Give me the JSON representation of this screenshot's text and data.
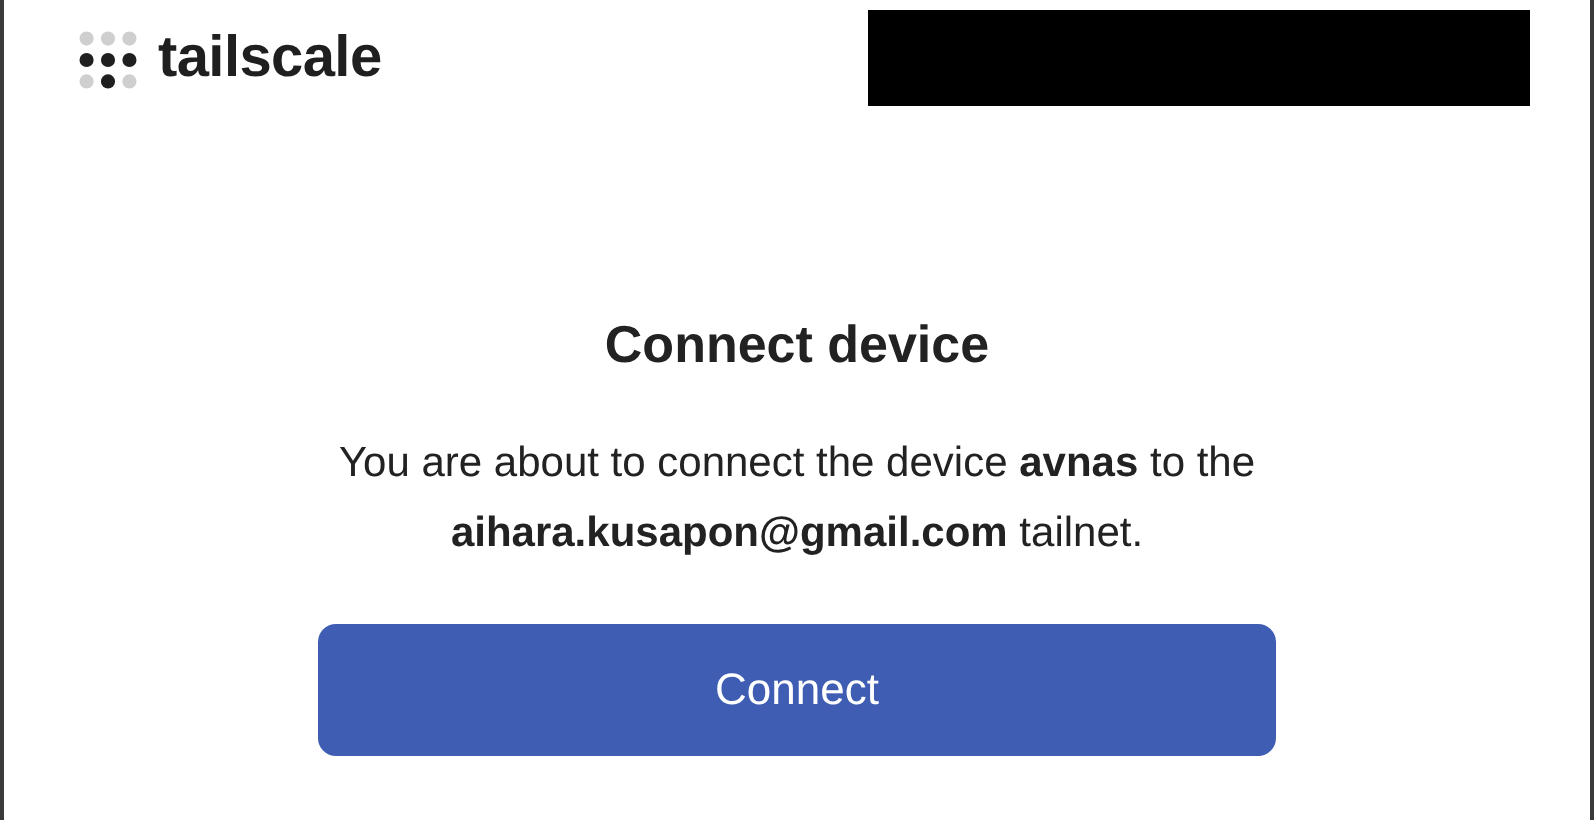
{
  "header": {
    "logo_text": "tailscale"
  },
  "dialog": {
    "title": "Connect device",
    "message": "You are about to connect the device **avnas** to the **aihara.kusapon@gmail.com** tailnet.",
    "button": "Connect"
  }
}
